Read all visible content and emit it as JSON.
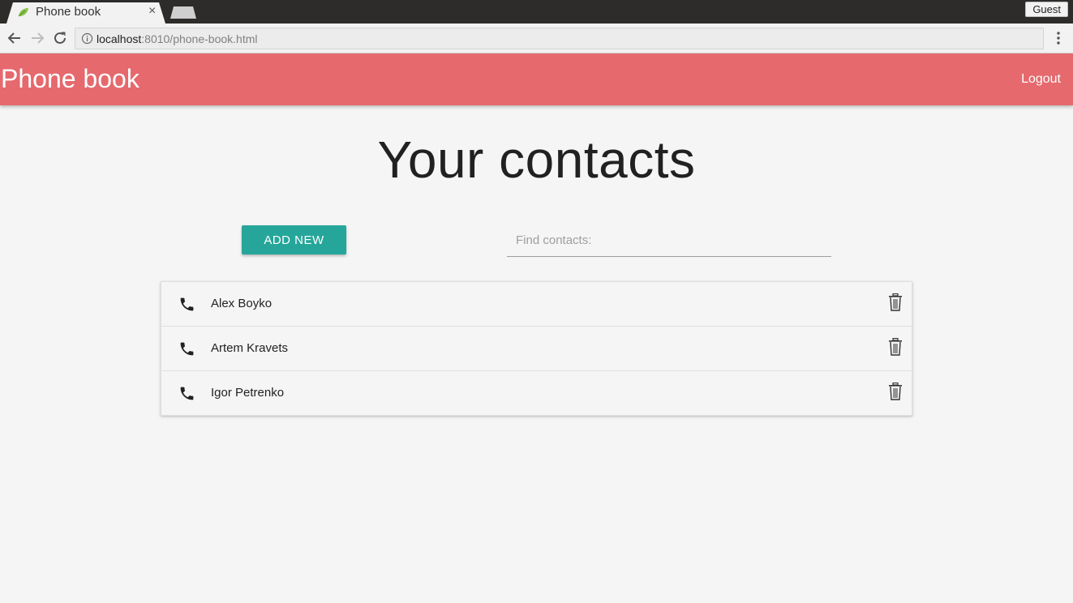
{
  "browser": {
    "tab_title": "Phone book",
    "tab_close": "×",
    "profile": "Guest",
    "url_host": "localhost",
    "url_rest": ":8010/phone-book.html"
  },
  "icons": {
    "favicon": "leaf-icon",
    "back": "back-arrow-icon",
    "forward": "forward-arrow-icon",
    "reload": "reload-icon",
    "info": "info-icon",
    "menu": "more-vert-icon",
    "phone": "phone-icon",
    "delete": "trash-icon"
  },
  "colors": {
    "appbar": "#e5696d",
    "primary_button": "#26a69a",
    "background": "#f5f5f5"
  },
  "header": {
    "brand": "Phone book",
    "logout": "Logout"
  },
  "main": {
    "title": "Your contacts",
    "add_button": "ADD NEW",
    "search_placeholder": "Find contacts:",
    "contacts": [
      {
        "name": "Alex Boyko"
      },
      {
        "name": "Artem Kravets"
      },
      {
        "name": "Igor Petrenko"
      }
    ]
  }
}
